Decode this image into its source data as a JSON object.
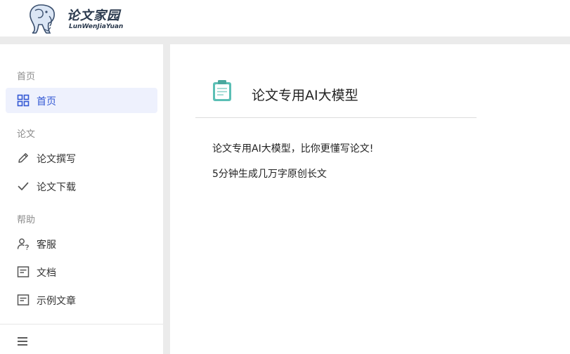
{
  "brand": {
    "title": "论文家园",
    "subtitle": "LunWenJiaYuan"
  },
  "sidebar": {
    "groups": [
      {
        "label": "首页",
        "items": [
          {
            "label": "首页",
            "icon": "grid-icon",
            "active": true
          }
        ]
      },
      {
        "label": "论文",
        "items": [
          {
            "label": "论文撰写",
            "icon": "pencil-icon",
            "active": false
          },
          {
            "label": "论文下载",
            "icon": "checkmark-icon",
            "active": false
          }
        ]
      },
      {
        "label": "帮助",
        "items": [
          {
            "label": "客服",
            "icon": "user-help-icon",
            "active": false
          },
          {
            "label": "文档",
            "icon": "document-icon",
            "active": false
          },
          {
            "label": "示例文章",
            "icon": "document-icon",
            "active": false
          }
        ]
      }
    ],
    "toggle_icon": "hamburger-menu-icon"
  },
  "main": {
    "card": {
      "icon": "clipboard-icon",
      "title": "论文专用AI大模型",
      "lines": [
        "论文专用AI大模型，比你更懂写论文!",
        "5分钟生成几万字原创长文"
      ]
    }
  },
  "colors": {
    "accent": "#3358d4",
    "active_bg": "#eef1fd",
    "page_bg": "#ebebeb",
    "clipboard": "#5bbfb5"
  }
}
